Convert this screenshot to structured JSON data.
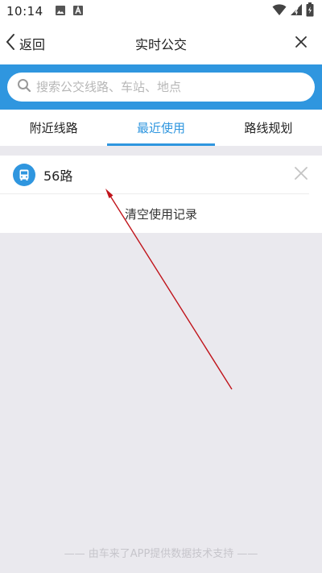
{
  "status_bar": {
    "time": "10:14"
  },
  "header": {
    "back_label": "返回",
    "title": "实时公交"
  },
  "search": {
    "placeholder": "搜索公交线路、车站、地点"
  },
  "tabs": [
    {
      "label": "附近线路"
    },
    {
      "label": "最近使用",
      "active": true
    },
    {
      "label": "路线规划"
    }
  ],
  "recent": {
    "items": [
      {
        "name": "56路"
      }
    ],
    "clear_label": "清空使用记录"
  },
  "footer": {
    "text": "—— 由车来了APP提供数据技术支持 ——"
  },
  "colors": {
    "accent": "#2f96df",
    "background": "#eae9ee",
    "annotation_arrow": "#c0141b"
  }
}
